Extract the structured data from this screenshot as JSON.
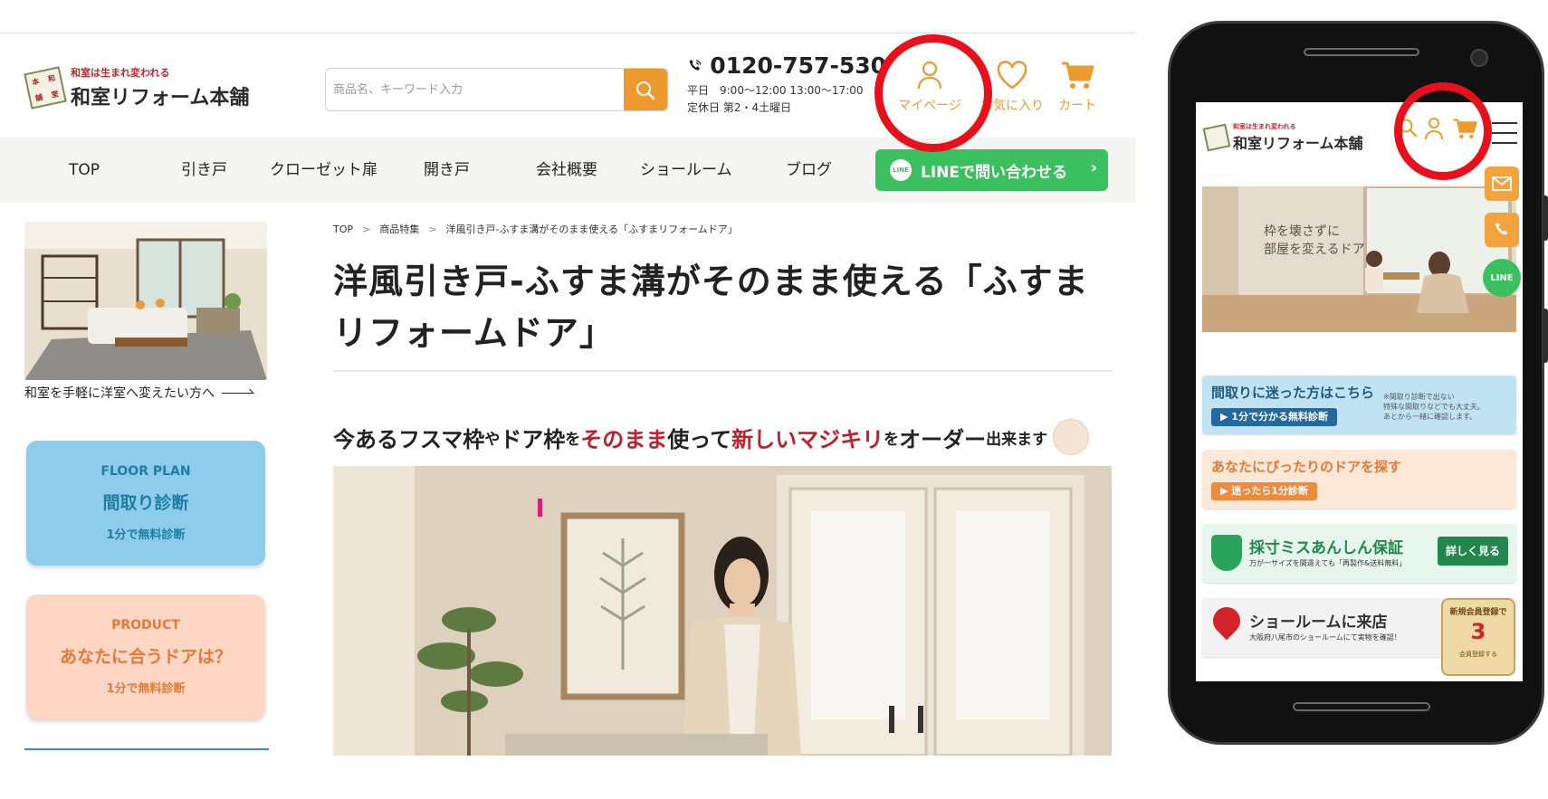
{
  "desktop": {
    "logo": {
      "tagline": "和室は生まれ変われる",
      "name": "和室リフォーム本舗",
      "seal_chars": [
        "本",
        "和",
        "舗",
        "室"
      ]
    },
    "search": {
      "placeholder": "商品名、キーワード入力",
      "icon": "search-icon"
    },
    "phone": {
      "number": "0120-757-530",
      "hours": "平日　9:00〜12:00 13:00〜17:00",
      "holiday": "定休日 第2・4土曜日",
      "icon": "phone-icon"
    },
    "header_icons": {
      "mypage": {
        "label": "マイページ",
        "icon": "user-icon"
      },
      "favorites": {
        "label": "お気に入り",
        "icon": "heart-icon"
      },
      "cart": {
        "label": "カート",
        "icon": "cart-icon"
      }
    },
    "nav": [
      "TOP",
      "引き戸",
      "クローゼット扉",
      "開き戸",
      "会社概要",
      "ショールーム",
      "ブログ"
    ],
    "line_button": {
      "label": "LINEで問い合わせる",
      "logo_text": "LINE"
    },
    "sidebar": {
      "hero_caption": "和室を手軽に洋室へ変えたい方へ",
      "cards": [
        {
          "en": "FLOOR PLAN",
          "jp": "間取り診断",
          "sub": "1分で無料診断"
        },
        {
          "en": "PRODUCT",
          "jp": "あなたに合うドアは？",
          "sub": "1分で無料診断"
        }
      ]
    },
    "main": {
      "breadcrumb": [
        "TOP",
        "商品特集",
        "洋風引き戸-ふすま溝がそのまま使える「ふすまリフォームドア」"
      ],
      "title_line1": "洋風引き戸-ふすま溝がそのまま使える「ふすま",
      "title_line2": "リフォームドア」",
      "catch": {
        "p1": "今あるフスマ枠",
        "p2": "や",
        "p3": "ドア枠",
        "p4": "を",
        "p5": "そのまま",
        "p6": "使って",
        "p7": "新しいマジキリ",
        "p8": "を",
        "p9": "オーダー",
        "p10": "出来ます"
      }
    }
  },
  "mobile": {
    "logo": {
      "tagline": "和室は生まれ変われる",
      "name": "和室リフォーム本舗"
    },
    "header_icons": [
      "search-icon",
      "user-icon",
      "cart-icon",
      "menu-icon"
    ],
    "hero_text_line1": "枠を壊さずに",
    "hero_text_line2": "部屋を変えるドア",
    "banners": [
      {
        "title": "間取りに迷った方はこちら",
        "pill": "▶ 1分で分かる無料診断",
        "note_line1": "※間取り診断で出ない",
        "note_line2": "特殊な間取りなどでも大丈夫。",
        "note_line3": "あとから一緒に確認します。"
      },
      {
        "title": "あなたにぴったりのドアを探す",
        "pill": "▶ 迷ったら1分診断"
      },
      {
        "title": "採寸ミスあんしん保証",
        "sub": "万が一サイズを間違えても「再製作&送料無料」",
        "button": "詳しく見る"
      },
      {
        "title": "ショールームに来店",
        "sub": "大阪府八尾市のショールームにて実物を確認！"
      }
    ],
    "member_badge": {
      "line1": "新規会員登録で",
      "big": "3",
      "line2": "会員登録する"
    },
    "float_buttons": [
      {
        "icon": "mail-icon"
      },
      {
        "icon": "phone-icon"
      },
      {
        "icon": "line-icon",
        "label": "LINE"
      }
    ]
  },
  "colors": {
    "accent_orange": "#ec9a2d",
    "line_green": "#3bc060",
    "highlight_red": "#e8101a",
    "brand_red": "#c0282e"
  }
}
